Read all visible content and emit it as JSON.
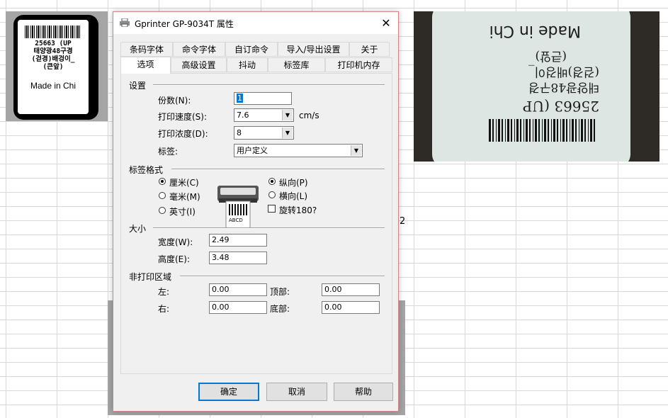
{
  "window": {
    "title": "Gprinter  GP-9034T 属性",
    "close_symbol": "✕"
  },
  "tabs_row1": [
    "条码字体",
    "命令字体",
    "自订命令",
    "导入/导出设置",
    "关于"
  ],
  "tabs_row2": [
    "选项",
    "高级设置",
    "抖动",
    "标签库",
    "打印机内存"
  ],
  "active_tab": "选项",
  "settings": {
    "group_title": "设置",
    "copies_label": "份数(N):",
    "copies_value": "1",
    "speed_label": "打印速度(S):",
    "speed_value": "7.6",
    "speed_unit": "cm/s",
    "density_label": "打印浓度(D):",
    "density_value": "8",
    "stock_label": "标签:",
    "stock_value": "用户定义"
  },
  "format": {
    "group_title": "标签格式",
    "units": [
      {
        "label": "厘米(C)",
        "selected": true
      },
      {
        "label": "毫米(M)",
        "selected": false
      },
      {
        "label": "英寸(I)",
        "selected": false
      }
    ],
    "orientation": [
      {
        "label": "纵向(P)",
        "selected": true
      },
      {
        "label": "横向(L)",
        "selected": false
      }
    ],
    "rotate_label": "旋转180?",
    "rotate_checked": false,
    "preview_text": "ABCD"
  },
  "size": {
    "group_title": "大小",
    "width_label": "宽度(W):",
    "width_value": "2.49",
    "height_label": "高度(E):",
    "height_value": "3.48"
  },
  "margins": {
    "group_title": "非打印区域",
    "left_label": "左:",
    "left_value": "0.00",
    "top_label": "顶部:",
    "top_value": "0.00",
    "right_label": "右:",
    "right_value": "0.00",
    "bottom_label": "底部:",
    "bottom_value": "0.00"
  },
  "buttons": {
    "ok": "确定",
    "cancel": "取消",
    "help": "帮助"
  },
  "label_preview": {
    "line1": "25663 (UP",
    "line2": "태양광48구경",
    "line3": "(걷경)배겅이_",
    "line4": "(큰앞)",
    "made": "Made in Chi"
  },
  "photo": {
    "made": "Made in Chi",
    "line1": "25663 (UP",
    "line2": "태양광48구경",
    "line3": "(걷경)배겅이_",
    "line4": "(큰앞)"
  },
  "sheet_fragment": "2",
  "colors": {
    "accent": "#0078d7",
    "dialog_border": "#d08585"
  }
}
